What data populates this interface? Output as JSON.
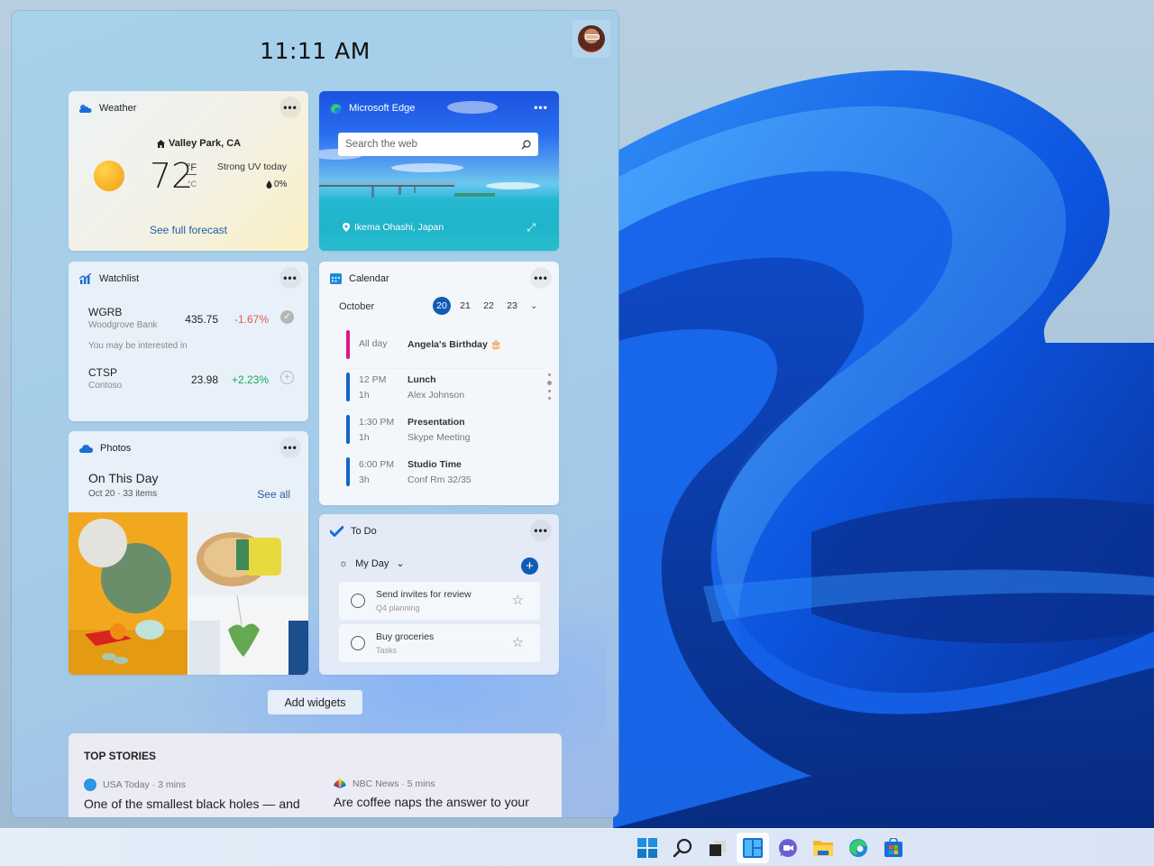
{
  "clock": "11:11 AM",
  "user": {
    "avatar_label": "Profile"
  },
  "weather": {
    "title": "Weather",
    "location": "Valley Park, CA",
    "temperature": "72",
    "unit_primary": "°F",
    "unit_secondary": "°C",
    "condition": "Strong UV today",
    "precipitation": "0%",
    "forecast_link": "See full forecast"
  },
  "edge": {
    "title": "Microsoft Edge",
    "search_placeholder": "Search the web",
    "image_location": "Ikema Ohashi, Japan"
  },
  "watchlist": {
    "title": "Watchlist",
    "stocks": [
      {
        "symbol": "WGRB",
        "name": "Woodgrove Bank",
        "price": "435.75",
        "change": "-1.67%",
        "direction": "down",
        "followed": true
      }
    ],
    "interest_label": "You may be interested in",
    "suggested": [
      {
        "symbol": "CTSP",
        "name": "Contoso",
        "price": "23.98",
        "change": "+2.23%",
        "direction": "up",
        "followed": false
      }
    ]
  },
  "calendar": {
    "title": "Calendar",
    "month": "October",
    "days": [
      "20",
      "21",
      "22",
      "23"
    ],
    "selected_day": "20",
    "events": [
      {
        "time": "All day",
        "duration": "",
        "title": "Angela's Birthday 🎂",
        "subtitle": "",
        "color": "#e0148c"
      },
      {
        "time": "12 PM",
        "duration": "1h",
        "title": "Lunch",
        "subtitle": "Alex  Johnson",
        "color": "#1466c4"
      },
      {
        "time": "1:30 PM",
        "duration": "1h",
        "title": "Presentation",
        "subtitle": "Skype Meeting",
        "color": "#1466c4"
      },
      {
        "time": "6:00 PM",
        "duration": "3h",
        "title": "Studio Time",
        "subtitle": "Conf Rm 32/35",
        "color": "#1466c4"
      }
    ]
  },
  "photos": {
    "title": "Photos",
    "heading": "On This Day",
    "subheading": "Oct 20 · 33 items",
    "see_all": "See all"
  },
  "todo": {
    "title": "To Do",
    "list_name": "My Day",
    "tasks": [
      {
        "title": "Send invites for review",
        "list": "Q4 planning"
      },
      {
        "title": "Buy groceries",
        "list": "Tasks"
      }
    ]
  },
  "add_widgets_label": "Add widgets",
  "top_stories": {
    "title": "TOP STORIES",
    "stories": [
      {
        "source": "USA Today · 3 mins",
        "headline": "One of the smallest black holes — and"
      },
      {
        "source": "NBC News · 5 mins",
        "headline": "Are coffee naps the answer to your"
      }
    ]
  },
  "taskbar": {
    "items": [
      {
        "name": "Start"
      },
      {
        "name": "Search"
      },
      {
        "name": "Task View"
      },
      {
        "name": "Widgets",
        "active": true
      },
      {
        "name": "Chat"
      },
      {
        "name": "File Explorer"
      },
      {
        "name": "Microsoft Edge"
      },
      {
        "name": "Microsoft Store"
      }
    ]
  },
  "colors": {
    "accent": "#0f5cb5",
    "negative": "#e05a4f",
    "positive": "#18a85a",
    "link": "#1f5fa8"
  }
}
